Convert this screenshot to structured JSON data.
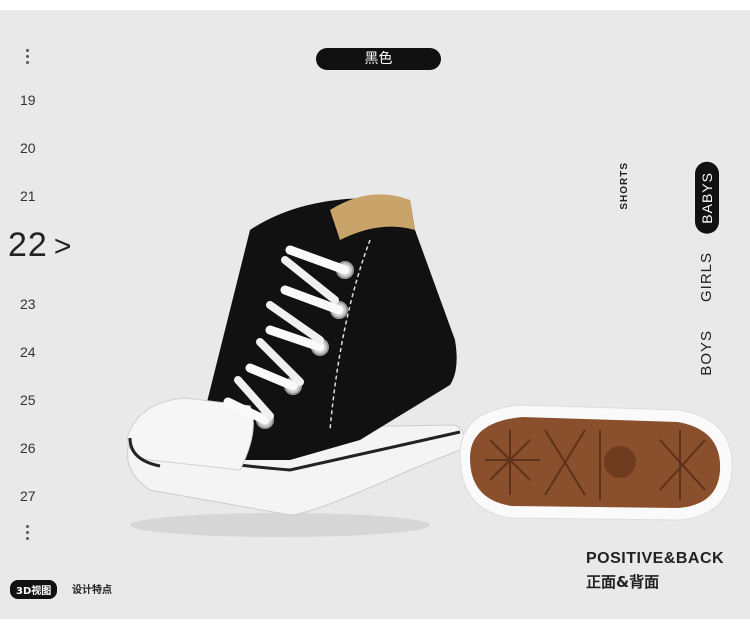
{
  "sizes": {
    "items": [
      "19",
      "20",
      "21",
      "23",
      "24",
      "25",
      "26",
      "27"
    ],
    "active": "22",
    "active_arrow": ">"
  },
  "color_label": "黑色",
  "categories": {
    "shorts": "SHORTS",
    "babys": "BABYS",
    "girls": "GIRLS",
    "boys": "BOYS"
  },
  "footer": {
    "title_en": "POSITIVE&BACK",
    "title_cn": "正面&背面",
    "badge": "3D视图",
    "badge_note": "设计特点"
  },
  "colors": {
    "background": "#e9e9e9",
    "pill": "#111111",
    "shoe_canvas": "#111111",
    "sole_rubber": "#8a4f2c"
  },
  "icons": [
    "vertical-dots-icon",
    "chevron-right-icon"
  ]
}
